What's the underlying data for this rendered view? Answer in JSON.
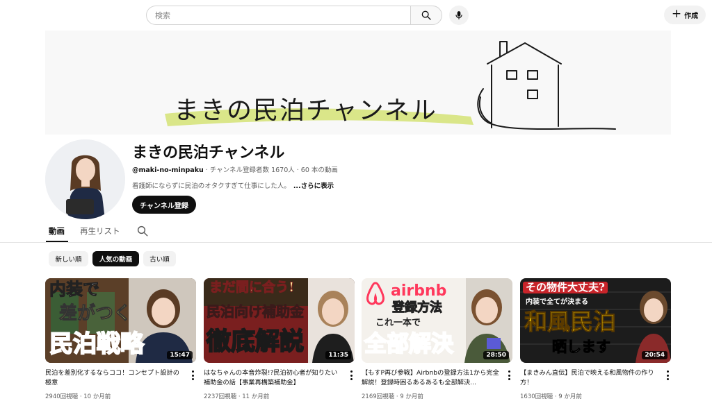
{
  "search": {
    "placeholder": "検索"
  },
  "topbar": {
    "create_label": "作成"
  },
  "banner": {
    "title": "まきの民泊チャンネル"
  },
  "channel": {
    "name": "まきの民泊チャンネル",
    "handle": "@maki-no-minpaku",
    "stats": " · チャンネル登録者数 1670人 · 60 本の動画",
    "description": "看護師にならずに民泊のオタクすぎて仕事にした人。",
    "more_label": "...さらに表示",
    "subscribe_label": "チャンネル登録"
  },
  "tabs": [
    {
      "label": "動画",
      "active": true
    },
    {
      "label": "再生リスト",
      "active": false
    }
  ],
  "chips": [
    {
      "label": "新しい順",
      "active": false
    },
    {
      "label": "人気の動画",
      "active": true
    },
    {
      "label": "古い順",
      "active": false
    }
  ],
  "videos": [
    {
      "title": "民泊を差別化するならココ！コンセプト設計の極意",
      "views": "2940回視聴",
      "age": "10 か月前",
      "duration": "15:47",
      "thumb_text": [
        "内装で",
        "差がつく",
        "民泊戦略"
      ]
    },
    {
      "title": "はなちゃんの本音炸裂!?民泊初心者が知りたい補助金の話【事業再構築補助金】",
      "views": "2237回視聴",
      "age": "11 か月前",
      "duration": "11:35",
      "thumb_text": [
        "まだ間に合う!",
        "民泊向け補助金",
        "徹底解説"
      ]
    },
    {
      "title": "【もすP再び参戦】Airbnbの登録方法1から完全解説！登録時困るあるあるも全部解決...",
      "views": "2169回視聴",
      "age": "9 か月前",
      "duration": "28:50",
      "thumb_text": [
        "airbnb",
        "登録方法",
        "これ一本で",
        "全部解決"
      ]
    },
    {
      "title": "【まきみん直伝】民泊で映える和風物件の作り方！",
      "views": "1630回視聴",
      "age": "9 か月前",
      "duration": "20:54",
      "thumb_text": [
        "その物件大丈夫?",
        "内装で全てが決まる",
        "和風民泊",
        "晒します"
      ]
    }
  ],
  "colors": {
    "accent_black": "#0f0f0f",
    "banner_bg": "#f8f8f8",
    "highlight_green": "#d6e37c",
    "airbnb_red": "#ff385c"
  }
}
